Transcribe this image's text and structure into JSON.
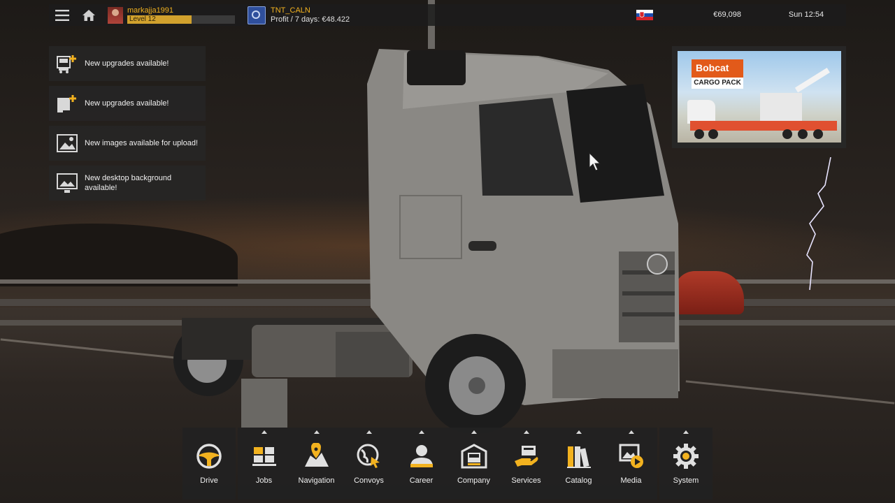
{
  "topbar": {
    "player_name": "markajja1991",
    "level_label": "Level 12",
    "level_progress": 0.6,
    "company_name": "TNT_CALN",
    "company_profit": "Profit / 7 days: €48.422",
    "money": "€69,098",
    "clock": "Sun 12:54"
  },
  "notifications": [
    {
      "text": "New upgrades available!",
      "icon": "truck-upgrade-icon"
    },
    {
      "text": "New upgrades available!",
      "icon": "trailer-upgrade-icon"
    },
    {
      "text": "New images available for upload!",
      "icon": "image-icon"
    },
    {
      "text": "New desktop background available!",
      "icon": "desktop-background-icon"
    }
  ],
  "ad": {
    "brand": "Bobcat",
    "title": "CARGO PACK"
  },
  "dock": {
    "drive": {
      "label": "Drive",
      "icon": "steering-wheel-icon"
    },
    "items": [
      {
        "label": "Jobs",
        "icon": "cargo-boxes-icon"
      },
      {
        "label": "Navigation",
        "icon": "map-pin-icon"
      },
      {
        "label": "Convoys",
        "icon": "globe-cursor-icon"
      },
      {
        "label": "Career",
        "icon": "person-icon"
      },
      {
        "label": "Company",
        "icon": "garage-truck-icon"
      },
      {
        "label": "Services",
        "icon": "service-hand-icon"
      },
      {
        "label": "Catalog",
        "icon": "catalog-books-icon"
      },
      {
        "label": "Media",
        "icon": "media-play-icon"
      }
    ],
    "system": {
      "label": "System",
      "icon": "gear-icon"
    }
  },
  "colors": {
    "accent": "#f2b21f",
    "panel": "#222222",
    "icon": "#e0e0e0"
  }
}
